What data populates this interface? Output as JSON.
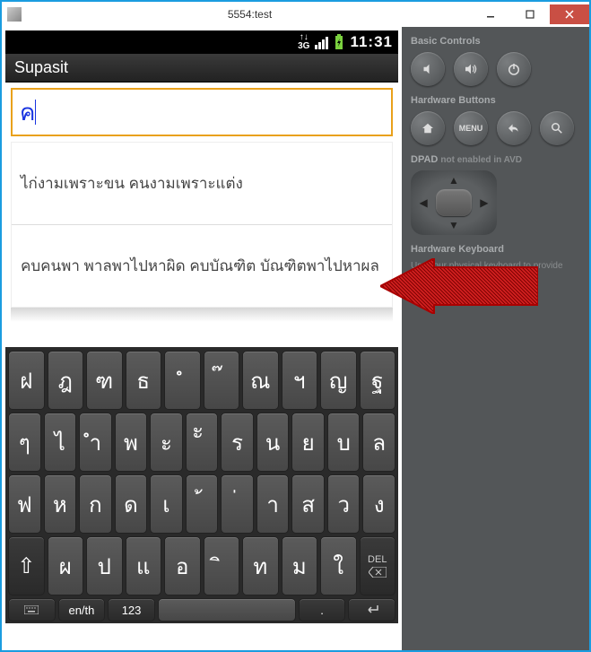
{
  "window": {
    "title": "5554:test"
  },
  "status": {
    "network": "3G",
    "clock": "11:31"
  },
  "app": {
    "title": "Supasit"
  },
  "input": {
    "value": "ค"
  },
  "list": {
    "items": [
      "ไก่งามเพราะขน คนงามเพราะแต่ง",
      "คบคนพา พาลพาไปหาผิด คบบัณฑิต บัณฑิตพาไปหาผล"
    ]
  },
  "keyboard": {
    "row1": [
      "ฝ",
      "ฎ",
      "ฑ",
      "ธ",
      "ํ",
      "๊",
      "ณ",
      "ฯ",
      "ญ",
      "ฐ"
    ],
    "row1_super": [
      "",
      "",
      "",
      "",
      "",
      "",
      "",
      "",
      "",
      ""
    ],
    "row2": [
      "ๆ",
      "ไ",
      "ำ",
      "พ",
      "ะ",
      "ัั",
      "ร",
      "น",
      "ย",
      "บ",
      "ล"
    ],
    "row3": [
      "ฟ",
      "ห",
      "ก",
      "ด",
      "เ",
      "้",
      "่",
      "า",
      "ส",
      "ว",
      "ง"
    ],
    "row4": [
      "⇧",
      "ผ",
      "ป",
      "แ",
      "อ",
      "ิ",
      "ท",
      "ม",
      "ใ"
    ],
    "del_label": "DEL",
    "bottom": {
      "kb": "",
      "lang": "en/th",
      "num": "123",
      "space": "␣",
      "enter": "↵"
    }
  },
  "side": {
    "basic": "Basic Controls",
    "hw": "Hardware Buttons",
    "menu": "MENU",
    "dpad": "DPAD",
    "dpad_note": "not enabled in AVD",
    "hk": "Hardware Keyboard",
    "hk_note": "Use your physical keyboard to provide input"
  }
}
